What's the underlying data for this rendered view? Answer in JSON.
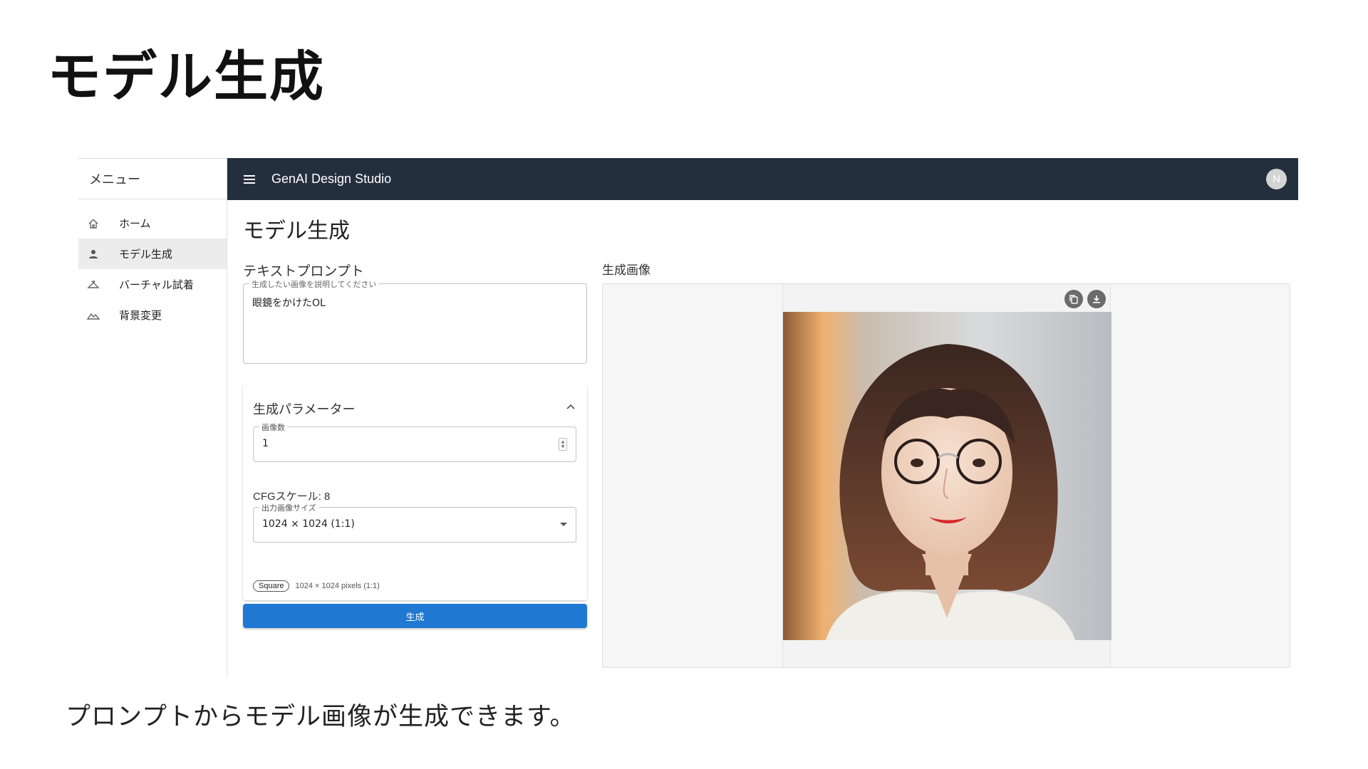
{
  "slide": {
    "title": "モデル生成",
    "caption": "プロンプトからモデル画像が生成できます。"
  },
  "drawer": {
    "header": "メニュー",
    "items": [
      {
        "label": "ホーム",
        "icon": "home-icon",
        "active": false
      },
      {
        "label": "モデル生成",
        "icon": "person-icon",
        "active": true
      },
      {
        "label": "バーチャル試着",
        "icon": "hanger-icon",
        "active": false
      },
      {
        "label": "背景変更",
        "icon": "landscape-icon",
        "active": false
      }
    ]
  },
  "appbar": {
    "title": "GenAI Design Studio",
    "avatar_initial": "N",
    "bg_color": "#242f3e"
  },
  "main": {
    "page_title": "モデル生成",
    "prompt": {
      "section_label": "テキストプロンプト",
      "field_label": "生成したい画像を説明してください",
      "value": "眼鏡をかけたOL"
    },
    "params": {
      "title": "生成パラメーター",
      "count": {
        "label": "画像数",
        "value": "1"
      },
      "cfg": {
        "label": "CFGスケール: 8",
        "value": 8,
        "min": 1,
        "max": 10,
        "fraction": 0.78
      },
      "size": {
        "label": "出力画像サイズ",
        "value": "1024 × 1024 (1:1)"
      },
      "chip": "Square",
      "chip_desc": "1024 × 1024 pixels (1:1)"
    },
    "generate_label": "生成",
    "generate_color": "#1f78d1",
    "result": {
      "section_label": "生成画像",
      "actions": [
        "copy-icon",
        "download-icon"
      ]
    }
  }
}
